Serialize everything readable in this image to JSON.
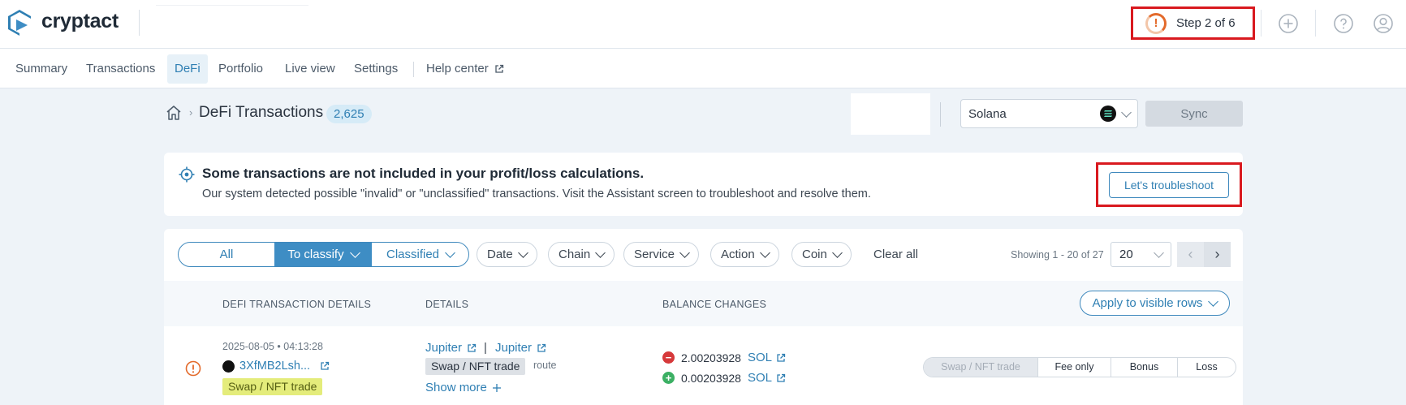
{
  "header": {
    "brand": "cryptact",
    "step_label": "Step 2 of 6",
    "icons": [
      "add-icon",
      "help-icon",
      "user-icon"
    ]
  },
  "nav": {
    "items": [
      {
        "label": "Summary"
      },
      {
        "label": "Transactions"
      },
      {
        "label": "DeFi"
      },
      {
        "label": "Portfolio"
      },
      {
        "label": "Live view"
      },
      {
        "label": "Settings"
      }
    ],
    "help": "Help center",
    "active": "DeFi"
  },
  "page": {
    "title": "DeFi Transactions",
    "count": "2,625",
    "chain_value": "Solana",
    "sync_label": "Sync"
  },
  "alert": {
    "title": "Some transactions are not included in your profit/loss calculations.",
    "description": "Our system detected possible \"invalid\" or \"unclassified\" transactions. Visit the Assistant screen to troubleshoot and resolve them.",
    "button": "Let's troubleshoot"
  },
  "filters": {
    "segments": {
      "all": "All",
      "to_classify": "To classify",
      "classified": "Classified"
    },
    "pills": {
      "date": "Date",
      "chain": "Chain",
      "service": "Service",
      "action": "Action",
      "coin": "Coin"
    },
    "clear_all": "Clear all",
    "showing": "Showing 1 - 20 of 27",
    "page_size": "20"
  },
  "table": {
    "headers": {
      "details_main": "DEFI TRANSACTION DETAILS",
      "details": "DETAILS",
      "balance": "BALANCE CHANGES"
    },
    "apply_label": "Apply to visible rows",
    "rows": [
      {
        "timestamp": "2025-08-05 • 04:13:28",
        "hash": "3XfMB2Lsh...",
        "type_tag": "Swap / NFT trade",
        "service_1": "Jupiter",
        "service_2": "Jupiter",
        "detail_tag": "Swap / NFT trade",
        "detail_note": "route",
        "show_more": "Show more",
        "balances": [
          {
            "amount": "2.00203928",
            "symbol": "SOL",
            "direction": "out"
          },
          {
            "amount": "0.00203928",
            "symbol": "SOL",
            "direction": "in"
          }
        ],
        "actions": [
          "Swap / NFT trade",
          "Fee only",
          "Bonus",
          "Loss"
        ]
      }
    ]
  },
  "colors": {
    "accent": "#2f7fb3",
    "highlight_red": "#d9191f",
    "warning_orange": "#e36a2b",
    "tag_yellow": "#e4ec7b"
  }
}
